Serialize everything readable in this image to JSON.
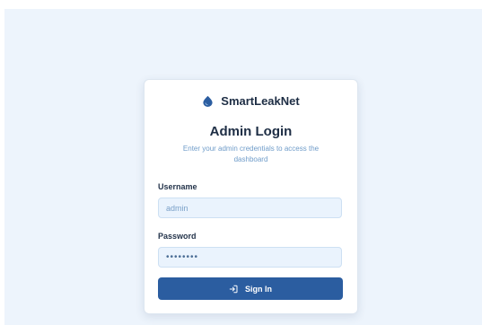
{
  "brand": {
    "name": "SmartLeakNet",
    "logo_icon": "water-drop-icon",
    "logo_color": "#2b5da0"
  },
  "login": {
    "title": "Admin Login",
    "subtitle": "Enter your admin credentials to access the dashboard",
    "username_label": "Username",
    "username_value": "admin",
    "password_label": "Password",
    "password_value": "••••••••",
    "submit_label": "Sign In",
    "submit_icon": "log-in-icon"
  },
  "colors": {
    "page_background": "#edf4fc",
    "accent": "#2b5da0",
    "input_background": "#eaf3fd"
  }
}
